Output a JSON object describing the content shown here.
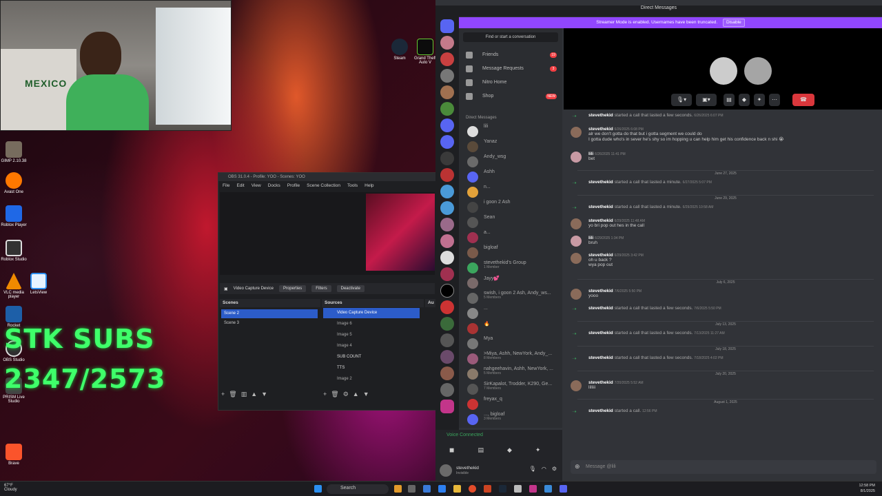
{
  "desktop": {
    "icons": [
      {
        "label": "GIMP 2.10.38"
      },
      {
        "label": "Avast One"
      },
      {
        "label": "Roblox Player"
      },
      {
        "label": "Roblox Studio"
      },
      {
        "label": "VLC media player"
      },
      {
        "label": "LetsView"
      },
      {
        "label": "Rocket"
      },
      {
        "label": "OBS Studio"
      },
      {
        "label": "PRISM Live Studio"
      },
      {
        "label": "Brave"
      },
      {
        "label": "Steam"
      },
      {
        "label": "Grand Theft Auto V"
      }
    ],
    "overlay_title": "STK SUBS",
    "overlay_count": "2347/2573"
  },
  "webcam": {
    "shirt_text": "MEXICO"
  },
  "obs": {
    "title": "OBS 31.0.4 - Profile: YOO - Scenes: YOO",
    "menu": [
      "File",
      "Edit",
      "View",
      "Docks",
      "Profile",
      "Scene Collection",
      "Tools",
      "Help"
    ],
    "toolbar": {
      "source_name": "Video Capture Device",
      "properties": "Properties",
      "filters": "Filters",
      "deactivate": "Deactivate"
    },
    "scenes_label": "Scenes",
    "sources_label": "Sources",
    "audio_label": "Au",
    "scenes": [
      "Scene 2",
      "Scene 3"
    ],
    "sources": [
      "Video Capture Device",
      "Image 6",
      "Image 5",
      "Image 4",
      "SUB COUNT",
      "TTS",
      "Image 2"
    ]
  },
  "discord": {
    "window_title": "Direct Messages",
    "streamer_banner": "Streamer Mode is enabled. Usernames have been truncated.",
    "disable_button": "Disable",
    "find_placeholder": "Find or start a conversation",
    "nav": [
      {
        "label": "Friends",
        "badge": "19"
      },
      {
        "label": "Message Requests",
        "badge": "3"
      },
      {
        "label": "Nitro Home",
        "badge": ""
      },
      {
        "label": "Shop",
        "badge": "NEW"
      }
    ],
    "dm_header": "Direct Messages",
    "dms": [
      {
        "name": "lili",
        "sub": ""
      },
      {
        "name": "Yanaz",
        "sub": ""
      },
      {
        "name": "Andy_wsg",
        "sub": ""
      },
      {
        "name": "Ashh",
        "sub": ""
      },
      {
        "name": "n...",
        "sub": ""
      },
      {
        "name": "i goon 2 Ash",
        "sub": ""
      },
      {
        "name": "Sean",
        "sub": ""
      },
      {
        "name": "a...",
        "sub": ""
      },
      {
        "name": "bigloaf",
        "sub": ""
      },
      {
        "name": "stevethekid's Group",
        "sub": "1 Member"
      },
      {
        "name": "Jayy💕",
        "sub": ""
      },
      {
        "name": "swish, i goon 2 Ash, Andy_ws...",
        "sub": "5 Members"
      },
      {
        "name": "...",
        "sub": ""
      },
      {
        "name": "🔥",
        "sub": ""
      },
      {
        "name": "Mya",
        "sub": ""
      },
      {
        "name": ">Miya, Ashh, NewYork, Andy_...",
        "sub": "8 Members"
      },
      {
        "name": "nahgeehavin, Ashh, NewYork, ...",
        "sub": "5 Members"
      },
      {
        "name": "SirKapalot, Trodder, K290, Ge...",
        "sub": "7 Members"
      },
      {
        "name": "freyax_q",
        "sub": ""
      },
      {
        "name": "..., bigloaf",
        "sub": "3 Members"
      }
    ],
    "voice_connected": "Voice Connected",
    "user": {
      "name": "stevethekid",
      "status": "Invisible"
    },
    "messages": [
      {
        "type": "sys",
        "author": "stevethekid",
        "text": "started a call that lasted a few seconds.",
        "time": "6/26/2025 6:07 PM"
      },
      {
        "type": "msg",
        "author": "stevethekid",
        "time": "6/26/2025 6:08 PM",
        "lines": [
          "alr we don't gotta do that but i gotta segment we could do",
          "I gotta dude who's in sever he's shy so im hopping u can help him get his confidence back n shi 😭"
        ]
      },
      {
        "type": "msg",
        "author": "lili",
        "time": "6/26/2025 11:41 PM",
        "lines": [
          "bet"
        ]
      },
      {
        "type": "date",
        "text": "June 27, 2025"
      },
      {
        "type": "sys",
        "author": "stevethekid",
        "text": "started a call that lasted a minute.",
        "time": "6/27/2025 5:07 PM"
      },
      {
        "type": "date",
        "text": "June 29, 2025"
      },
      {
        "type": "sys",
        "author": "stevethekid",
        "text": "started a call that lasted a minute.",
        "time": "6/29/2025 10:58 AM"
      },
      {
        "type": "msg",
        "author": "stevethekid",
        "time": "6/29/2025 11:48 AM",
        "lines": [
          "yo bri pop out hes in the call"
        ]
      },
      {
        "type": "msg",
        "author": "lili",
        "time": "6/29/2025 1:34 PM",
        "lines": [
          "bruh"
        ]
      },
      {
        "type": "msg",
        "author": "stevethekid",
        "time": "6/29/2025 3:42 PM",
        "lines": [
          "oh u back ?",
          "wya pop out"
        ]
      },
      {
        "type": "date",
        "text": "July 6, 2025"
      },
      {
        "type": "msg",
        "author": "stevethekid",
        "time": "7/6/2025 5:50 PM",
        "lines": [
          "yooo"
        ]
      },
      {
        "type": "sys",
        "author": "stevethekid",
        "text": "started a call that lasted a few seconds.",
        "time": "7/6/2025 5:50 PM"
      },
      {
        "type": "date",
        "text": "July 13, 2025"
      },
      {
        "type": "sys",
        "author": "stevethekid",
        "text": "started a call that lasted a few seconds.",
        "time": "7/13/2025 11:27 AM"
      },
      {
        "type": "date",
        "text": "July 18, 2025"
      },
      {
        "type": "sys",
        "author": "stevethekid",
        "text": "started a call that lasted a few seconds.",
        "time": "7/18/2025 4:02 PM"
      },
      {
        "type": "date",
        "text": "July 20, 2025"
      },
      {
        "type": "msg",
        "author": "stevethekid",
        "time": "7/20/2025 5:52 AM",
        "lines": [
          "lilliii"
        ]
      },
      {
        "type": "date",
        "text": "August 1, 2025"
      },
      {
        "type": "sys",
        "author": "stevethekid",
        "text": "started a call.",
        "time": "12:56 PM"
      }
    ],
    "input_placeholder": "Message @lili"
  },
  "taskbar": {
    "weather_temp": "67°F",
    "weather_desc": "Cloudy",
    "search_label": "Search",
    "time": "12:58 PM",
    "date": "8/1/2025"
  },
  "colors": {
    "discord_bg": "#313338",
    "streamer_banner": "#9146ff",
    "hangup": "#da373c",
    "obs_selected": "#2c5cc9",
    "subs_green": "#3fff6a"
  }
}
